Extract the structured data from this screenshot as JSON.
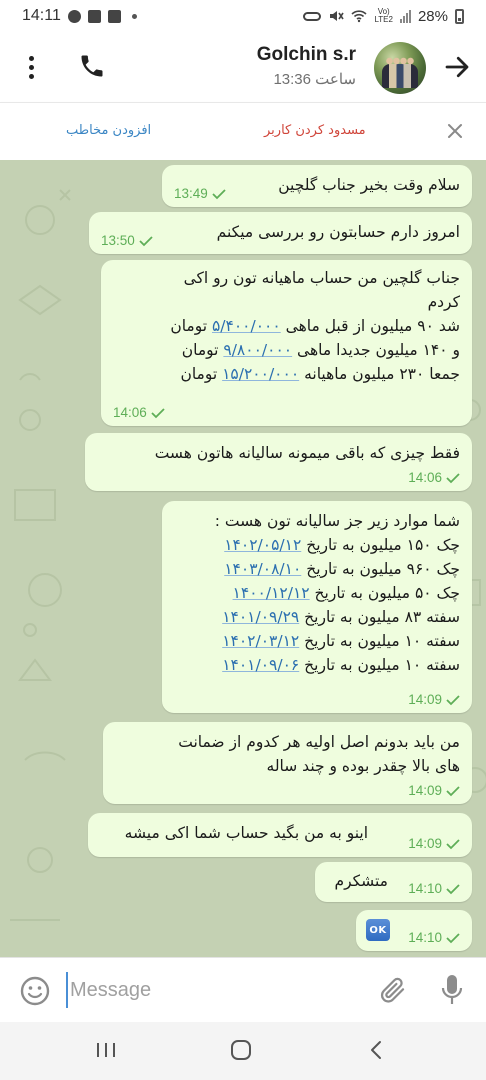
{
  "status_bar": {
    "time": "14:11",
    "network": "Vo)\nLTE2",
    "battery": "28%"
  },
  "header": {
    "contact_name": "Golchin s.r",
    "last_seen": "ساعت 13:36"
  },
  "action_bar": {
    "add_contact": "افزودن مخاطب",
    "block_user": "مسدود کردن کاربر"
  },
  "messages": [
    {
      "lines": [
        "سلام وقت بخیر جناب گلچین"
      ],
      "time": "13:49"
    },
    {
      "lines": [
        "امروز دارم حسابتون رو بررسی میکنم"
      ],
      "time": "13:50"
    },
    {
      "lines": [
        "جناب گلچین من حساب ماهیانه تون رو اکی",
        "کردم",
        "شد ۹۰ میلیون از قبل ماهی ۵/۴۰۰/۰۰۰ تومان",
        "و ۱۴۰ میلیون جدیدا ماهی ۹/۸۰۰/۰۰۰ تومان",
        "جمعا ۲۳۰ میلیون ماهیانه ۱۵/۲۰۰/۰۰۰ تومان"
      ],
      "time": "14:06"
    },
    {
      "lines": [
        "فقط چیزی که باقی میمونه سالیانه هاتون هست"
      ],
      "time": "14:06"
    },
    {
      "lines": [
        "شما موارد زیر جز سالیانه تون هست :",
        "چک ۱۵۰ میلیون به تاریخ ۱۴۰۲/۰۵/۱۲",
        "چک ۹۶۰ میلیون به تاریخ ۱۴۰۳/۰۸/۱۰",
        "چک ۵۰ میلیون به تاریخ ۱۴۰۰/۱۲/۱۲",
        "سفته ۸۳ میلیون به تاریخ ۱۴۰۱/۰۹/۲۹",
        "سفته ۱۰ میلیون به تاریخ ۱۴۰۲/۰۳/۱۲",
        "سفته ۱۰ میلیون به تاریخ ۱۴۰۱/۰۹/۰۶"
      ],
      "time": "14:09"
    },
    {
      "lines": [
        "من باید بدونم اصل اولیه هر کدوم از ضمانت",
        "های بالا چقدر بوده و چند ساله"
      ],
      "time": "14:09"
    },
    {
      "lines": [
        "اینو به من بگید حساب شما اکی میشه"
      ],
      "time": "14:09"
    },
    {
      "lines": [
        "متشکرم"
      ],
      "time": "14:10"
    },
    {
      "emoji": "OK",
      "time": "14:10"
    }
  ],
  "input": {
    "placeholder": "Message"
  },
  "icons": {
    "menu": "more-vertical-icon",
    "call": "phone-icon",
    "back": "arrow-right-icon",
    "close": "close-icon",
    "emoji": "emoji-icon",
    "attach": "paperclip-icon",
    "mic": "microphone-icon"
  },
  "colors": {
    "bubble": "#effdde",
    "chat_bg": "#c4d1b3",
    "check": "#5eae57",
    "link": "#2b6fb0",
    "block": "#d0463b",
    "add": "#3b86c4"
  }
}
